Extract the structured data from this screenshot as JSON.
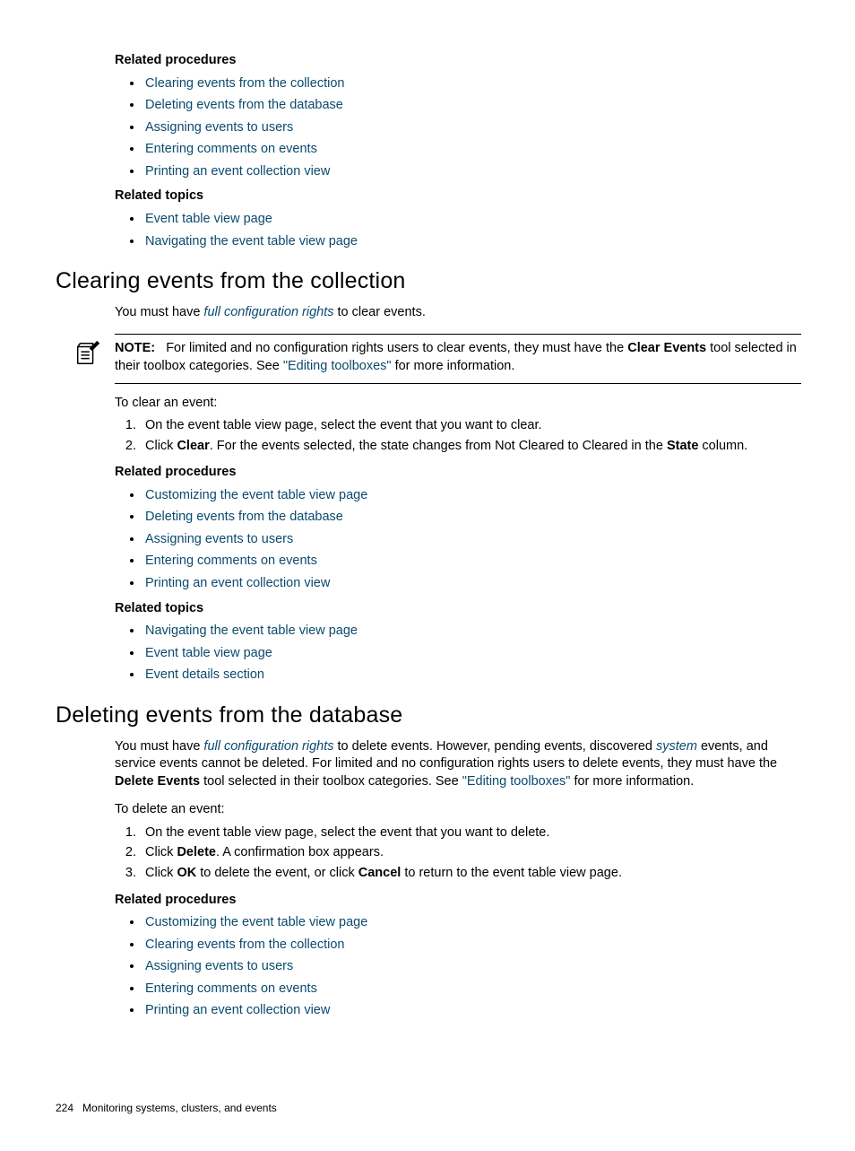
{
  "top": {
    "related_procedures_label": "Related procedures",
    "procedures": [
      "Clearing events from the collection",
      "Deleting events from the database",
      "Assigning events to users",
      "Entering comments on events",
      "Printing an event collection view"
    ],
    "related_topics_label": "Related topics",
    "topics": [
      "Event table view page",
      "Navigating the event table view page"
    ]
  },
  "section1": {
    "title": "Clearing events from the collection",
    "intro_pre": "You must have ",
    "intro_link": "full configuration rights",
    "intro_post": " to clear events.",
    "note_label": "NOTE:",
    "note_pre": "For limited and no configuration rights users to clear events, they must have the ",
    "note_bold": "Clear Events",
    "note_mid": " tool selected in their toolbox categories. See ",
    "note_link": "\"Editing toolboxes\"",
    "note_post": " for more information.",
    "lead": "To clear an event:",
    "step1": "On the event table view page, select the event that you want to clear.",
    "step2_pre": "Click ",
    "step2_bold1": "Clear",
    "step2_mid": ". For the events selected, the state changes from Not Cleared to Cleared in the ",
    "step2_bold2": "State",
    "step2_post": " column.",
    "related_procedures_label": "Related procedures",
    "procedures": [
      "Customizing the event table view page",
      "Deleting events from the database",
      "Assigning events to users",
      "Entering comments on events",
      "Printing an event collection view"
    ],
    "related_topics_label": "Related topics",
    "topics": [
      "Navigating the event table view page",
      "Event table view page",
      "Event details section"
    ]
  },
  "section2": {
    "title": "Deleting events from the database",
    "p_pre": "You must have ",
    "p_link1": "full configuration rights",
    "p_mid1": " to delete events. However, pending events, discovered ",
    "p_link2": "system",
    "p_mid2": " events, and service events cannot be deleted. For limited and no configuration rights users to delete events, they must have the ",
    "p_bold": "Delete Events",
    "p_mid3": " tool selected in their toolbox categories. See ",
    "p_link3": "\"Editing toolboxes\"",
    "p_post": " for more information.",
    "lead": "To delete an event:",
    "step1": "On the event table view page, select the event that you want to delete.",
    "step2_pre": "Click ",
    "step2_bold": "Delete",
    "step2_post": ". A confirmation box appears.",
    "step3_pre": "Click ",
    "step3_bold1": "OK",
    "step3_mid": " to delete the event, or click ",
    "step3_bold2": "Cancel",
    "step3_post": " to return to the event table view page.",
    "related_procedures_label": "Related procedures",
    "procedures": [
      "Customizing the event table view page",
      "Clearing events from the collection",
      "Assigning events to users",
      "Entering comments on events",
      "Printing an event collection view"
    ]
  },
  "footer": {
    "page": "224",
    "chapter": "Monitoring systems, clusters, and events"
  }
}
